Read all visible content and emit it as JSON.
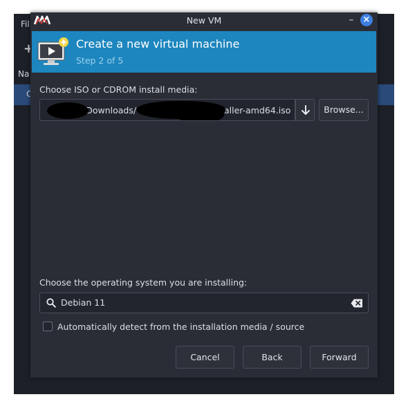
{
  "background_window": {
    "menu_label": "Fil",
    "plus_icon": "plus-icon",
    "column_header": "Na",
    "selected_row_text": "C"
  },
  "dialog": {
    "title": "New VM",
    "minimize_symbol": "–",
    "close_symbol": "×",
    "header": {
      "title": "Create a new virtual machine",
      "step": "Step 2 of 5",
      "icon": "virtual-machine-icon"
    },
    "iso": {
      "label": "Choose ISO or CDROM install media:",
      "path_segments": {
        "part1": "/Downloads/",
        "part2": "aller-amd64.iso"
      },
      "dropdown_icon": "arrow-down-icon",
      "browse_label": "Browse..."
    },
    "os": {
      "label": "Choose the operating system you are installing:",
      "search_value": "Debian 11",
      "search_icon": "search-icon",
      "clear_icon": "backspace-clear-icon",
      "auto_detect_label": "Automatically detect from the installation media / source",
      "auto_detect_checked": false
    },
    "buttons": {
      "cancel": "Cancel",
      "back": "Back",
      "forward": "Forward"
    }
  },
  "colors": {
    "header_bg": "#1d86be",
    "dialog_bg": "#2a2d36",
    "close_button": "#3d7fe0",
    "selection": "#2a4a7a"
  }
}
